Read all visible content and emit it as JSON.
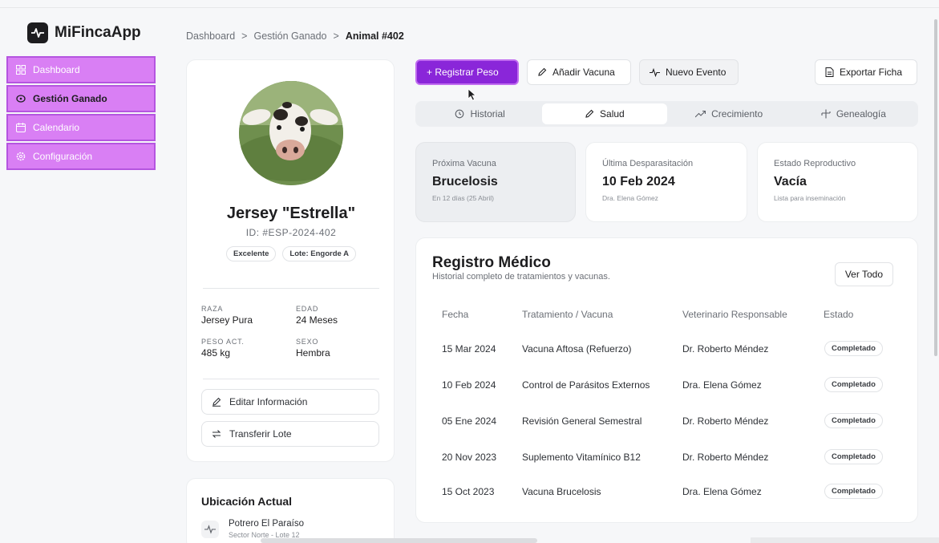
{
  "app": {
    "name": "MiFincaApp"
  },
  "sidebar": {
    "items": [
      {
        "label": "Dashboard",
        "icon": "grid-icon"
      },
      {
        "label": "Gestión Ganado",
        "icon": "cow-icon",
        "active": true
      },
      {
        "label": "Calendario",
        "icon": "calendar-icon"
      },
      {
        "label": "Configuración",
        "icon": "gear-icon"
      }
    ]
  },
  "breadcrumb": {
    "items": [
      "Dashboard",
      "Gestión Ganado",
      "Animal #402"
    ],
    "separator": ">"
  },
  "profile": {
    "name": "Jersey \"Estrella\"",
    "id": "ID: #ESP-2024-402",
    "tags": [
      "Excelente",
      "Lote: Engorde A"
    ],
    "attributes": {
      "raza": {
        "label": "RAZA",
        "value": "Jersey Pura"
      },
      "edad": {
        "label": "EDAD",
        "value": "24 Meses"
      },
      "peso": {
        "label": "PESO ACT.",
        "value": "485 kg"
      },
      "sexo": {
        "label": "SEXO",
        "value": "Hembra"
      }
    },
    "edit_label": "Editar Información",
    "transfer_label": "Transferir Lote"
  },
  "location": {
    "title": "Ubicación Actual",
    "name": "Potrero El Paraíso",
    "sub": "Sector Norte - Lote 12"
  },
  "actions": {
    "register_weight": "+ Registrar Peso",
    "add_vaccine": "Añadir Vacuna",
    "new_event": "Nuevo Evento",
    "export": "Exportar Ficha"
  },
  "tabs": [
    {
      "label": "Historial",
      "icon": "history-icon"
    },
    {
      "label": "Salud",
      "icon": "syringe-icon",
      "active": true
    },
    {
      "label": "Crecimiento",
      "icon": "trend-icon"
    },
    {
      "label": "Genealogía",
      "icon": "tree-icon"
    }
  ],
  "stats": [
    {
      "label": "Próxima Vacuna",
      "value": "Brucelosis",
      "sub": "En 12 días (25 Abril)"
    },
    {
      "label": "Última Desparasitación",
      "value": "10 Feb 2024",
      "sub": "Dra. Elena Gómez"
    },
    {
      "label": "Estado Reproductivo",
      "value": "Vacía",
      "sub": "Lista para inseminación"
    }
  ],
  "records": {
    "title": "Registro Médico",
    "subtitle": "Historial completo de tratamientos y vacunas.",
    "view_all": "Ver Todo",
    "columns": [
      "Fecha",
      "Tratamiento / Vacuna",
      "Veterinario Responsable",
      "Estado"
    ],
    "rows": [
      {
        "fecha": "15 Mar 2024",
        "tratamiento": "Vacuna Aftosa (Refuerzo)",
        "veterinario": "Dr. Roberto Méndez",
        "estado": "Completado"
      },
      {
        "fecha": "10 Feb 2024",
        "tratamiento": "Control de Parásitos Externos",
        "veterinario": "Dra. Elena Gómez",
        "estado": "Completado"
      },
      {
        "fecha": "05 Ene 2024",
        "tratamiento": "Revisión General Semestral",
        "veterinario": "Dr. Roberto Méndez",
        "estado": "Completado"
      },
      {
        "fecha": "20 Nov 2023",
        "tratamiento": "Suplemento Vitamínico B12",
        "veterinario": "Dr. Roberto Méndez",
        "estado": "Completado"
      },
      {
        "fecha": "15 Oct 2023",
        "tratamiento": "Vacuna Brucelosis",
        "veterinario": "Dra. Elena Gómez",
        "estado": "Completado"
      }
    ]
  },
  "colors": {
    "accent": "#8a26d9",
    "sidebar_highlight": "#d97ff4"
  }
}
